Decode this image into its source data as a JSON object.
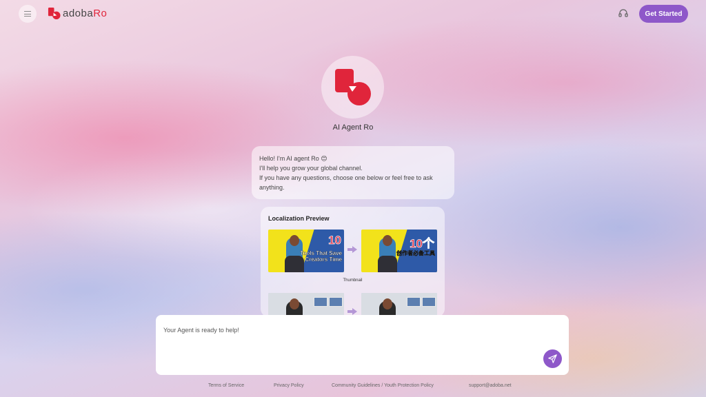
{
  "header": {
    "logo_text_a": "adoba",
    "logo_text_b": "Ro",
    "menu_icon": "hamburger-icon",
    "support_icon": "headset-icon",
    "cta_label": "Get Started",
    "accent_color": "#8e58c9",
    "brand_color": "#e0253b"
  },
  "agent": {
    "name": "AI Agent Ro",
    "greeting": {
      "line1": "Hello! I'm AI agent Ro 😊",
      "line2": "I'll help you grow your global channel.",
      "line3": "If you have any questions, choose one below or feel free to ask anything."
    }
  },
  "preview": {
    "title": "Localization Preview",
    "thumbnail_label": "Thumbnail",
    "original": {
      "number": "10",
      "caption": "Tools That Save Creators Time"
    },
    "localized": {
      "number": "10个",
      "caption": "创作者必备工具"
    }
  },
  "composer": {
    "placeholder": "Your Agent is ready to help!",
    "send_icon": "send-icon"
  },
  "footer": {
    "links": [
      "Terms of Service",
      "Privacy Policy",
      "Community Guidelines / Youth Protection Policy",
      "support@adoba.net"
    ]
  }
}
